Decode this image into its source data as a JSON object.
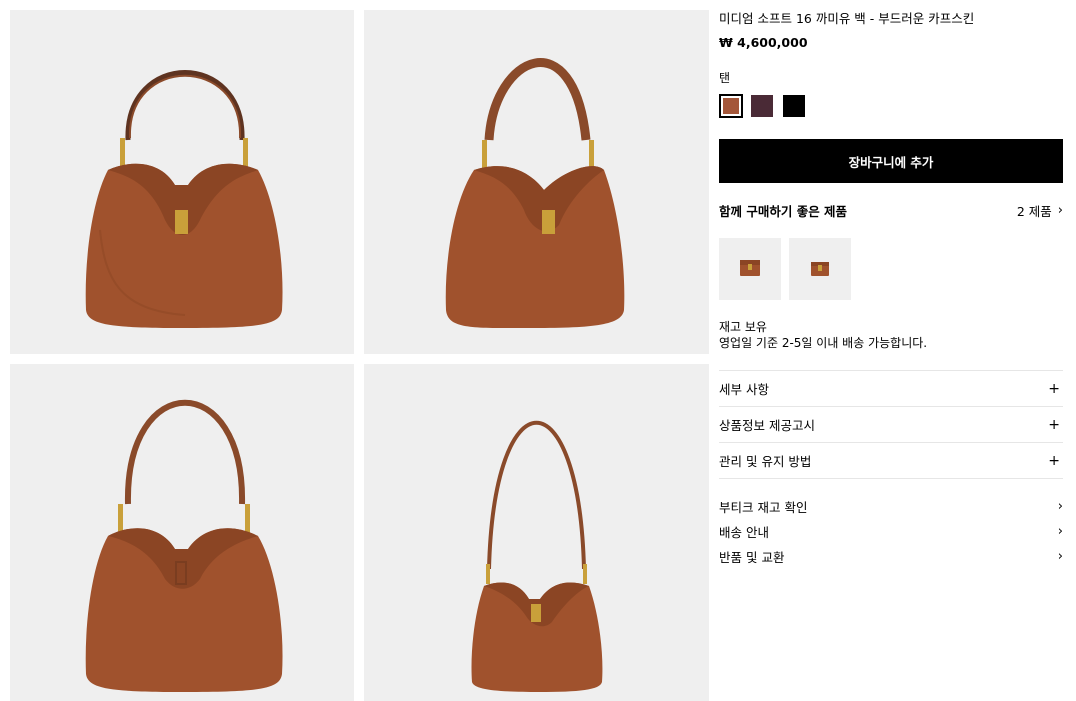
{
  "product": {
    "title": "미디엄 소프트 16 까미유 백 - 부드러운 카프스킨",
    "price": "₩ 4,600,000",
    "color_label": "탠",
    "swatches": [
      {
        "name": "tan",
        "color": "#a4573a",
        "selected": true
      },
      {
        "name": "burgundy",
        "color": "#4a2a36",
        "selected": false
      },
      {
        "name": "black",
        "color": "#000000",
        "selected": false
      }
    ],
    "add_to_cart": "장바구니에 추가"
  },
  "pairing": {
    "title": "함께 구매하기 좋은 제품",
    "count": "2 제품"
  },
  "stock": {
    "status": "재고 보유",
    "delivery": "영업일 기준 2-5일 이내 배송 가능합니다."
  },
  "accordion": [
    {
      "label": "세부 사항",
      "icon": "plus-icon"
    },
    {
      "label": "상품정보 제공고시",
      "icon": "plus-icon"
    },
    {
      "label": "관리 및 유지 방법",
      "icon": "plus-icon"
    }
  ],
  "links": [
    {
      "label": "부티크 재고 확인",
      "icon": "chevron-right-icon"
    },
    {
      "label": "배송 안내",
      "icon": "chevron-right-icon"
    },
    {
      "label": "반품 및 교환",
      "icon": "chevron-right-icon"
    }
  ],
  "colors": {
    "leather": "#a0522d",
    "leather_dark": "#7a3d20",
    "hardware": "#c9a03a",
    "tile_bg": "#efefef"
  }
}
